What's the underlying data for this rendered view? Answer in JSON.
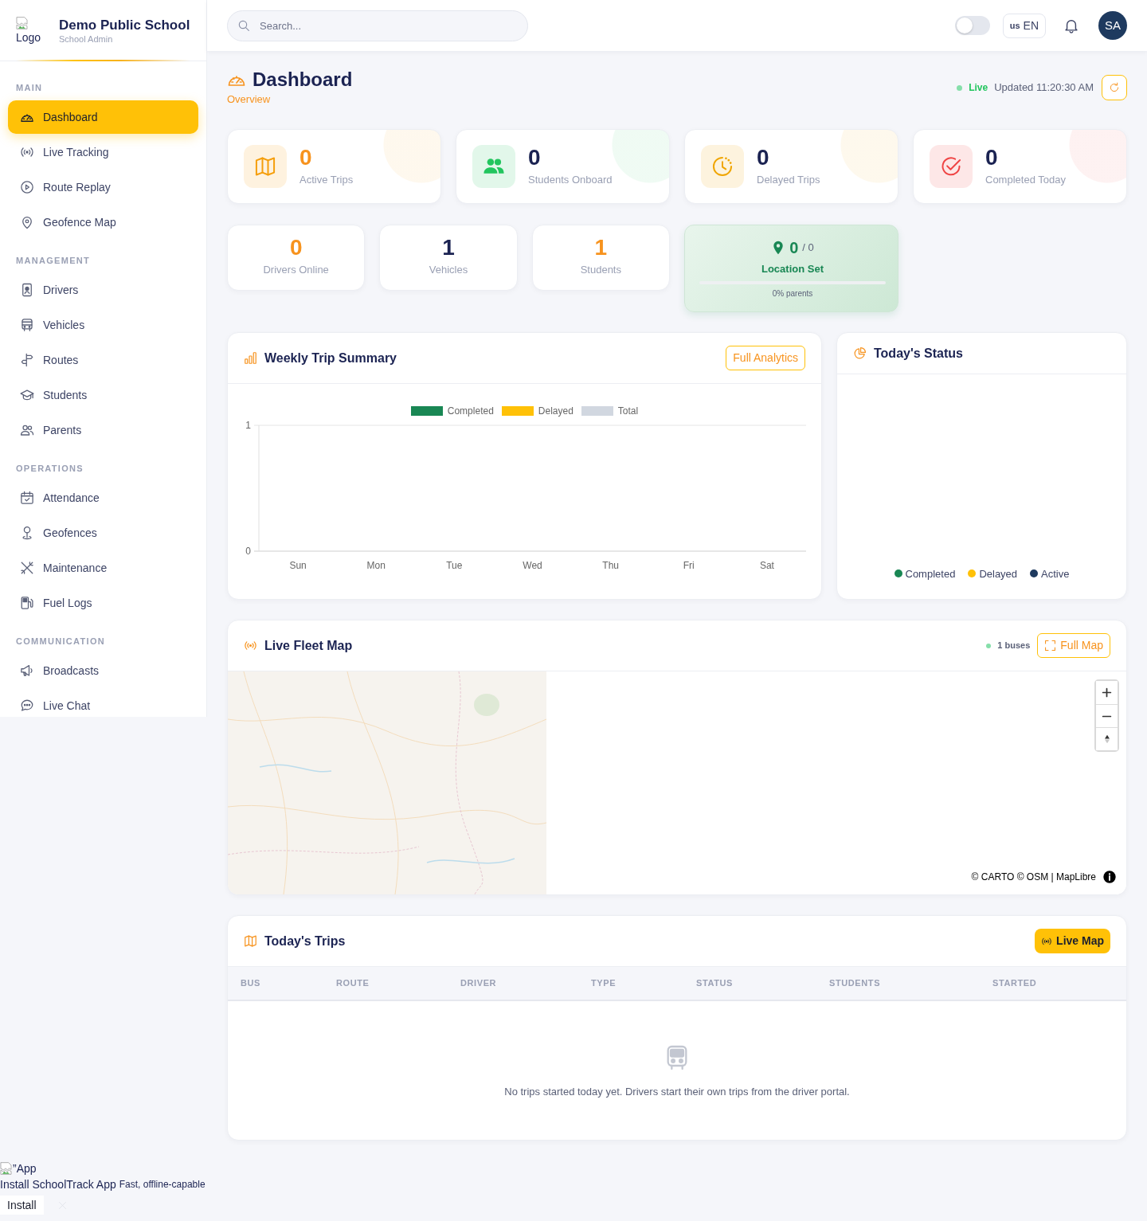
{
  "sidebar": {
    "logo_alt": "Logo",
    "title": "Demo Public School",
    "subtitle": "School Admin",
    "sections": [
      {
        "heading": "MAIN",
        "items": [
          {
            "label": "Dashboard",
            "selected": true
          },
          {
            "label": "Live Tracking",
            "selected": false
          },
          {
            "label": "Route Replay",
            "selected": false
          },
          {
            "label": "Geofence Map",
            "selected": false
          }
        ]
      },
      {
        "heading": "MANAGEMENT",
        "items": [
          {
            "label": "Drivers",
            "selected": false
          },
          {
            "label": "Vehicles",
            "selected": false
          },
          {
            "label": "Routes",
            "selected": false
          },
          {
            "label": "Students",
            "selected": false
          },
          {
            "label": "Parents",
            "selected": false
          }
        ]
      },
      {
        "heading": "OPERATIONS",
        "items": [
          {
            "label": "Attendance",
            "selected": false
          },
          {
            "label": "Geofences",
            "selected": false
          },
          {
            "label": "Maintenance",
            "selected": false
          },
          {
            "label": "Fuel Logs",
            "selected": false
          }
        ]
      },
      {
        "heading": "COMMUNICATION",
        "items": [
          {
            "label": "Broadcasts",
            "selected": false
          },
          {
            "label": "Live Chat",
            "selected": false
          }
        ]
      }
    ]
  },
  "topbar": {
    "search": {
      "placeholder": "Search..."
    },
    "theme_toggle": {
      "on": false
    },
    "language": {
      "flag": "us",
      "label": "EN"
    },
    "avatar": "SA"
  },
  "page_header": {
    "title": "Dashboard",
    "subtitle": "Overview",
    "status": "Live",
    "updated": "Updated 11:20:30 AM"
  },
  "stat_cards": [
    {
      "value": "0",
      "label": "Active Trips",
      "kind": "accent",
      "color": "#f59e0b"
    },
    {
      "value": "0",
      "label": "Students Onboard",
      "kind": "plain",
      "color": "#22c55e"
    },
    {
      "value": "0",
      "label": "Delayed Trips",
      "kind": "plain",
      "color": "#f0a500"
    },
    {
      "value": "0",
      "label": "Completed Today",
      "kind": "plain",
      "color": "#ef4444"
    }
  ],
  "mini_stats": [
    {
      "value": "0",
      "label": "Drivers Online",
      "kind": "accent"
    },
    {
      "value": "1",
      "label": "Vehicles",
      "kind": "plain"
    },
    {
      "value": "1",
      "label": "Students",
      "kind": "accent"
    }
  ],
  "location_card": {
    "value": "0",
    "total": "/ 0",
    "label": "Location Set",
    "level": 0,
    "caption": "0% parents"
  },
  "weekly_trip_summary": {
    "title": "Weekly Trip Summary",
    "button": "Full Analytics",
    "chart_data": {
      "type": "bar",
      "categories": [
        "Sun",
        "Mon",
        "Tue",
        "Wed",
        "Thu",
        "Fri",
        "Sat"
      ],
      "series": [
        {
          "name": "Completed",
          "color": "#198754",
          "values": [
            0,
            0,
            0,
            0,
            0,
            0,
            0
          ]
        },
        {
          "name": "Delayed",
          "color": "#ffc107",
          "values": [
            0,
            0,
            0,
            0,
            0,
            0,
            0
          ]
        },
        {
          "name": "Total",
          "color": "#d1d7e0",
          "values": [
            0,
            0,
            0,
            0,
            0,
            0,
            0
          ]
        }
      ],
      "ylim": [
        0,
        1
      ],
      "yticks": [
        0,
        1
      ]
    }
  },
  "todays_status": {
    "title": "Today's Status",
    "legend": [
      {
        "label": "Completed",
        "color": "#198754"
      },
      {
        "label": "Delayed",
        "color": "#ffc107"
      },
      {
        "label": "Active",
        "color": "#1e3a5f"
      }
    ]
  },
  "live_fleet_map": {
    "title": "Live Fleet Map",
    "bus_count": "1 buses",
    "button": "Full Map",
    "attribution": "© CARTO © OSM | MapLibre"
  },
  "todays_trips": {
    "title": "Today's Trips",
    "button": "Live Map",
    "columns": [
      "BUS",
      "ROUTE",
      "DRIVER",
      "TYPE",
      "STATUS",
      "STUDENTS",
      "STARTED"
    ],
    "empty_message": "No trips started today yet. Drivers start their own trips from the driver portal."
  },
  "install_banner": {
    "image_alt": "”App",
    "title": "Install SchoolTrack App",
    "subtitle": "Fast, offline-capable",
    "button": "Install"
  }
}
